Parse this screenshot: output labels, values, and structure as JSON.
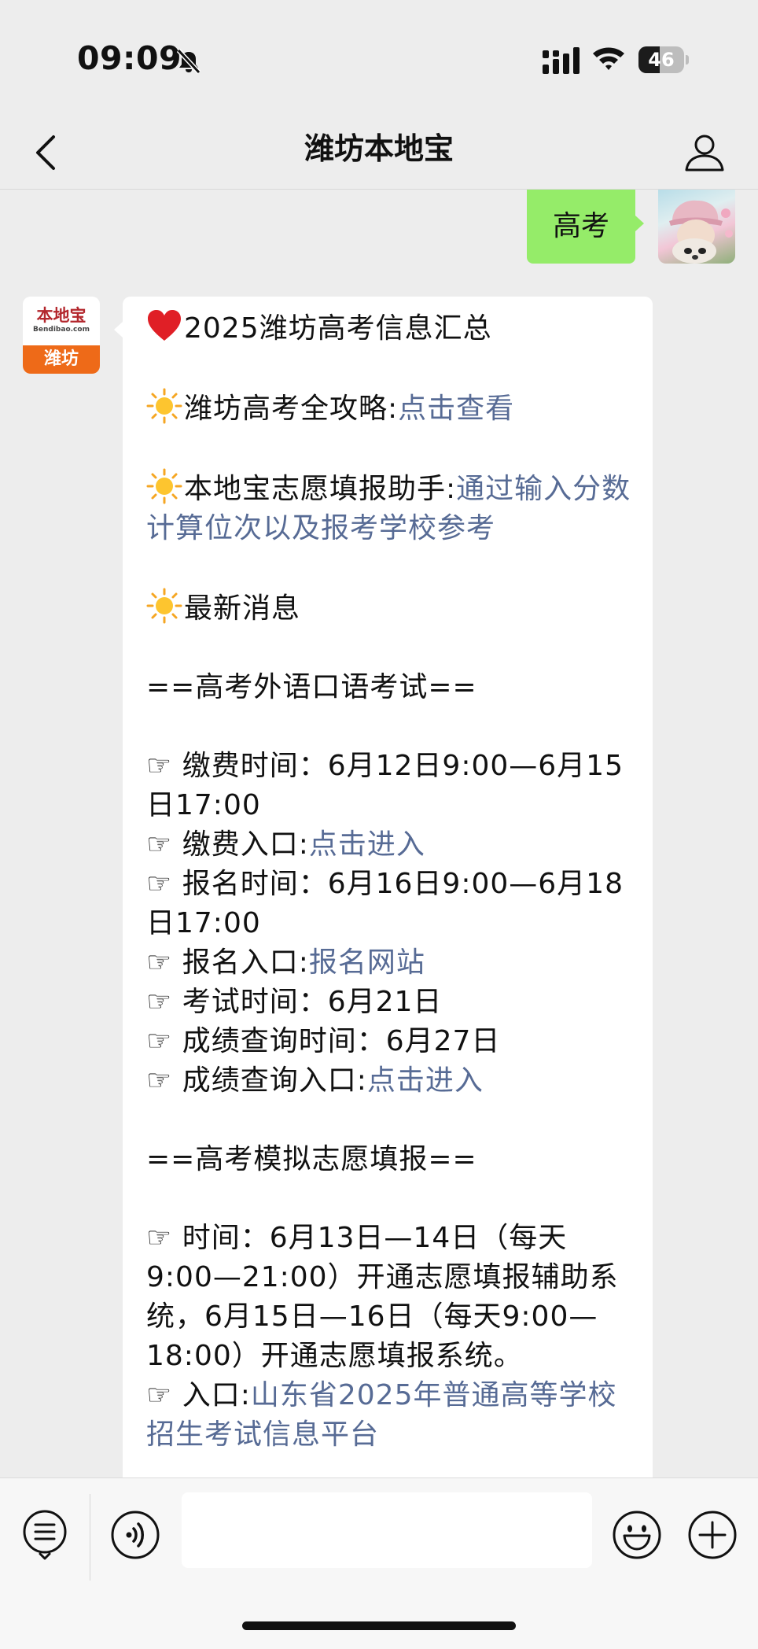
{
  "status_bar": {
    "time": "09:09",
    "battery_level": "46",
    "battery_fraction": 0.46,
    "icons": [
      "bell-slash-icon",
      "cellular-signal-icon",
      "wifi-icon",
      "battery-icon"
    ]
  },
  "nav": {
    "title": "潍坊本地宝",
    "back_icon": "chevron-left-icon",
    "profile_icon": "person-icon"
  },
  "chat": {
    "my_message": {
      "text": "高考",
      "bubble_color": "#95ec69"
    },
    "bot": {
      "avatar_brand": "本地宝",
      "avatar_domain": "Bendibao.com",
      "avatar_city": "潍坊",
      "brand_color": "#ee6a18"
    },
    "bot_message": {
      "title": "2025潍坊高考信息汇总",
      "guide_label": "潍坊高考全攻略:",
      "guide_link": "点击查看",
      "assistant_label": "本地宝志愿填报助手:",
      "assistant_link": "通过输入分数计算位次以及报考学校参考",
      "news_label": "最新消息",
      "oral_exam_header": "==高考外语口语考试==",
      "pay_time": "☞ 缴费时间：6月12日9:00—6月15日17:00",
      "pay_entry_label": "☞ 缴费入口:",
      "pay_entry_link": "点击进入",
      "signup_time": "☞ 报名时间：6月16日9:00—6月18日17:00",
      "signup_entry_label": "☞ 报名入口:",
      "signup_entry_link": "报名网站",
      "exam_time": "☞ 考试时间：6月21日",
      "score_time": "☞ 成绩查询时间：6月27日",
      "score_entry_label": "☞ 成绩查询入口:",
      "score_entry_link": "点击进入",
      "mock_header": "==高考模拟志愿填报==",
      "mock_time": "☞ 时间：6月13日—14日（每天9:00—21:00）开通志愿填报辅助系统，6月15日—16日（每天9:00—18:00）开通志愿填报系统。",
      "mock_entry_label": "☞ 入口:",
      "mock_entry_link": "山东省2025年普通高等学校招生考试信息平台",
      "link_color": "#576b95"
    }
  },
  "input_bar": {
    "icons": [
      "list-menu-icon",
      "voice-icon",
      "smiley-icon",
      "plus-icon"
    ],
    "input_value": ""
  }
}
